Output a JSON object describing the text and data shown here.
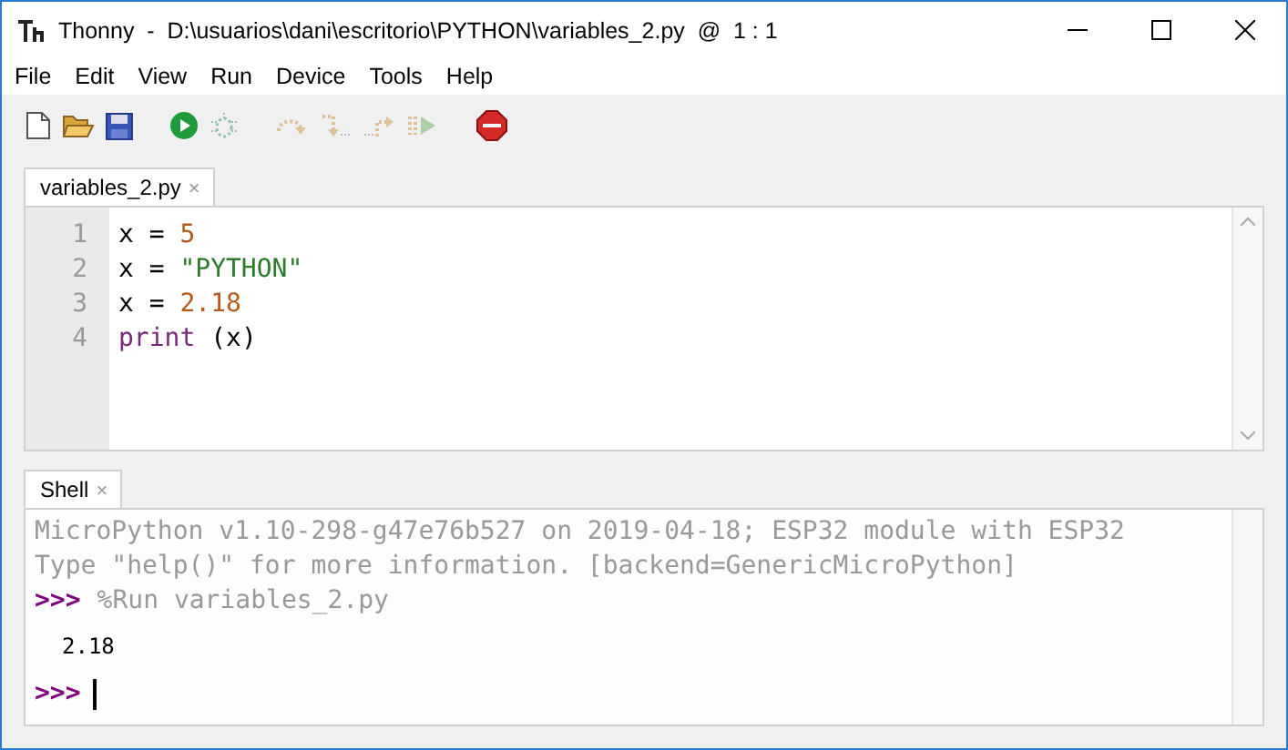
{
  "window": {
    "title": "Thonny  -  D:\\usuarios\\dani\\escritorio\\PYTHON\\variables_2.py  @  1 : 1"
  },
  "menu": [
    "File",
    "Edit",
    "View",
    "Run",
    "Device",
    "Tools",
    "Help"
  ],
  "toolbar": [
    {
      "kind": "new",
      "disabled": false
    },
    {
      "kind": "open",
      "disabled": false
    },
    {
      "kind": "save",
      "disabled": false
    },
    {
      "kind": "run",
      "disabled": false
    },
    {
      "kind": "debug",
      "disabled": true
    },
    {
      "kind": "step_over",
      "disabled": true
    },
    {
      "kind": "step_into",
      "disabled": true
    },
    {
      "kind": "step_out",
      "disabled": true
    },
    {
      "kind": "resume",
      "disabled": true
    },
    {
      "kind": "stop",
      "disabled": false
    }
  ],
  "editor": {
    "tabs": [
      {
        "label": "variables_2.py",
        "close": "×",
        "selected": true
      }
    ],
    "lines": [
      {
        "number": "1",
        "tokens": [
          {
            "kind": "plain",
            "text": "x = "
          },
          {
            "kind": "number",
            "text": "5"
          }
        ]
      },
      {
        "number": "2",
        "tokens": [
          {
            "kind": "plain",
            "text": "x = "
          },
          {
            "kind": "string",
            "text": "\"PYTHON\""
          }
        ]
      },
      {
        "number": "3",
        "tokens": [
          {
            "kind": "plain",
            "text": "x = "
          },
          {
            "kind": "number",
            "text": "2.18"
          }
        ]
      },
      {
        "number": "4",
        "tokens": [
          {
            "kind": "builtin",
            "text": "print"
          },
          {
            "kind": "plain",
            "text": " (x)"
          }
        ]
      }
    ]
  },
  "shell": {
    "tabs": [
      {
        "label": "Shell",
        "close": "×",
        "selected": true
      }
    ],
    "lines": [
      {
        "kind": "banner",
        "text": "MicroPython v1.10-298-g47e76b527 on 2019-04-18; ESP32 module with ESP32"
      },
      {
        "kind": "banner",
        "text": "Type \"help()\" for more information. [backend=GenericMicroPython]"
      },
      {
        "kind": "command",
        "prompt": ">>>",
        "text": "%Run variables_2.py"
      },
      {
        "kind": "output",
        "text": "2.18"
      },
      {
        "kind": "input",
        "prompt": ">>>"
      }
    ]
  }
}
